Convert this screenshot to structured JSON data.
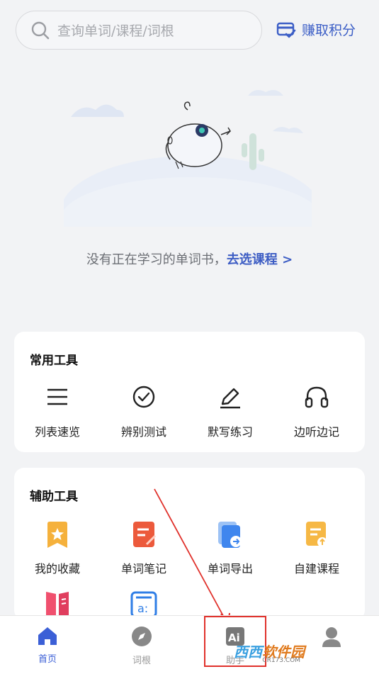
{
  "search": {
    "placeholder": "查询单词/课程/词根"
  },
  "earn_points": {
    "label": "赚取积分"
  },
  "empty_state": {
    "message": "没有正在学习的单词书，",
    "link": "去选课程 >"
  },
  "common_tools": {
    "title": "常用工具",
    "items": [
      {
        "label": "列表速览",
        "icon": "list-icon"
      },
      {
        "label": "辨别测试",
        "icon": "check-circle-icon"
      },
      {
        "label": "默写练习",
        "icon": "pencil-icon"
      },
      {
        "label": "边听边记",
        "icon": "headphones-icon"
      }
    ]
  },
  "aux_tools": {
    "title": "辅助工具",
    "items": [
      {
        "label": "我的收藏",
        "icon": "star-bookmark-icon"
      },
      {
        "label": "单词笔记",
        "icon": "note-edit-icon"
      },
      {
        "label": "单词导出",
        "icon": "export-icon"
      },
      {
        "label": "自建课程",
        "icon": "create-course-icon"
      },
      {
        "label": "",
        "icon": "book-icon"
      },
      {
        "label": "",
        "icon": "word-card-icon"
      }
    ]
  },
  "tabbar": {
    "items": [
      {
        "label": "首页",
        "icon": "home-icon",
        "active": true
      },
      {
        "label": "词根",
        "icon": "compass-icon",
        "active": false
      },
      {
        "label": "助手",
        "icon": "ai-icon",
        "active": false
      },
      {
        "label": "",
        "icon": "profile-icon",
        "active": false
      }
    ]
  },
  "ai_icon_text": "Ai",
  "watermark": {
    "part1": "西西",
    "part2": "软件园",
    "sub": "CR173.COM"
  },
  "colors": {
    "accent": "#3b5fd6",
    "highlight": "#e0312b"
  }
}
